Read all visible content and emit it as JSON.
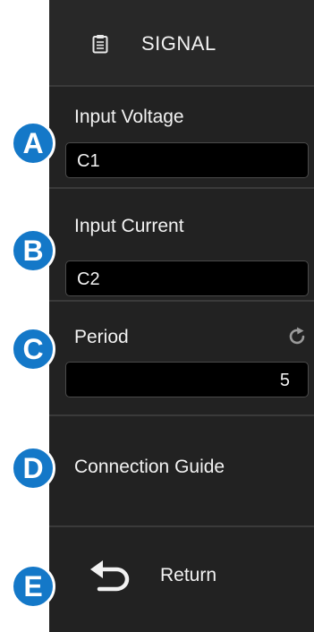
{
  "header": {
    "title": "SIGNAL",
    "icon": "clipboard-icon"
  },
  "input_voltage": {
    "label": "Input Voltage",
    "value": "C1"
  },
  "input_current": {
    "label": "Input Current",
    "value": "C2"
  },
  "period": {
    "label": "Period",
    "value": "5",
    "reset_icon": "refresh-icon"
  },
  "connection_guide": {
    "label": "Connection Guide"
  },
  "return": {
    "label": "Return",
    "icon": "return-arrow-icon"
  },
  "badges": [
    "A",
    "B",
    "C",
    "D",
    "E"
  ],
  "colors": {
    "panel": "#222222",
    "field": "#000000",
    "badge": "#1478c8",
    "text": "#f2f2f2"
  }
}
